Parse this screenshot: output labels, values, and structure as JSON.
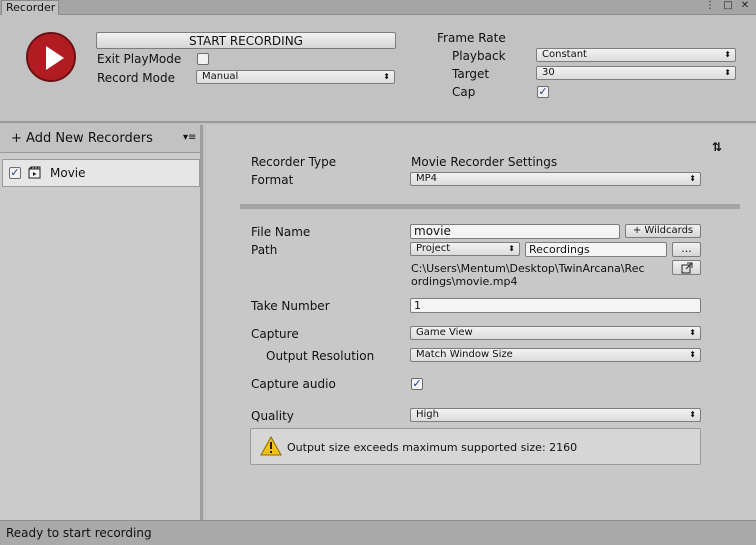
{
  "window": {
    "tab_title": "Recorder",
    "controls": {
      "menu": "⋮",
      "maximize": "□",
      "close": "✕"
    }
  },
  "top": {
    "start_button": "START RECORDING",
    "exit_playmode_label": "Exit PlayMode",
    "exit_playmode_checked": false,
    "record_mode_label": "Record Mode",
    "record_mode_value": "Manual",
    "frame_rate_label": "Frame Rate",
    "playback_label": "Playback",
    "playback_value": "Constant",
    "target_label": "Target",
    "target_value": "30",
    "cap_label": "Cap",
    "cap_checked": true,
    "record_icon": "play-record-icon",
    "record_color": "#b01c22"
  },
  "left": {
    "add_new_label": "+ Add New Recorders",
    "menu_glyph": "▾≡",
    "recorders": [
      {
        "name": "Movie",
        "checked": true,
        "icon": "movie-icon"
      }
    ]
  },
  "settings": {
    "settings_glyph": "⇅",
    "recorder_type_label": "Recorder Type",
    "recorder_type_value": "Movie Recorder Settings",
    "format_label": "Format",
    "format_value": "MP4",
    "file_name_label": "File Name",
    "file_name_value": "movie",
    "wildcards_label": "+ Wildcards",
    "path_label": "Path",
    "path_root_value": "Project",
    "path_folder_value": "Recordings",
    "browse_label": "...",
    "full_path_line1": "C:\\Users\\Mentum\\Desktop\\TwinArcana\\Rec",
    "full_path_line2": "ordings\\movie.mp4",
    "take_number_label": "Take Number",
    "take_number_value": "1",
    "capture_label": "Capture",
    "capture_value": "Game View",
    "output_resolution_label": "Output Resolution",
    "output_resolution_value": "Match Window Size",
    "capture_audio_label": "Capture audio",
    "capture_audio_checked": true,
    "quality_label": "Quality",
    "quality_value": "High",
    "warning_text": "Output size exceeds maximum supported size: 2160"
  },
  "status": {
    "text": "Ready to start recording"
  }
}
